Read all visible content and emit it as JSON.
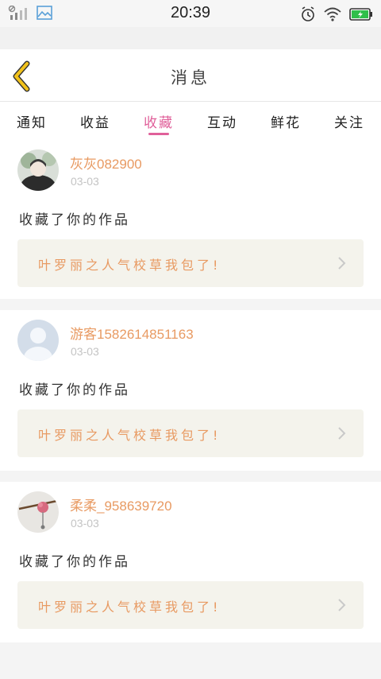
{
  "statusbar": {
    "time": "20:39"
  },
  "header": {
    "title": "消息"
  },
  "tabs": [
    {
      "label": "通知",
      "active": false
    },
    {
      "label": "收益",
      "active": false
    },
    {
      "label": "收藏",
      "active": true
    },
    {
      "label": "互动",
      "active": false
    },
    {
      "label": "鲜花",
      "active": false
    },
    {
      "label": "关注",
      "active": false
    }
  ],
  "feed": [
    {
      "username": "灰灰082900",
      "date": "03-03",
      "action": "收藏了你的作品",
      "work_title": "叶罗丽之人气校草我包了!"
    },
    {
      "username": "游客1582614851163",
      "date": "03-03",
      "action": "收藏了你的作品",
      "work_title": "叶罗丽之人气校草我包了!"
    },
    {
      "username": "柔柔_958639720",
      "date": "03-03",
      "action": "收藏了你的作品",
      "work_title": "叶罗丽之人气校草我包了!"
    }
  ],
  "colors": {
    "accent": "#e0609a",
    "username": "#e89a62",
    "back_arrow": "#f2c21b"
  },
  "icons": [
    "no-sim-signal-icon",
    "gallery-icon",
    "alarm-icon",
    "wifi-icon",
    "battery-icon",
    "back-chevron-icon",
    "chevron-right-icon"
  ]
}
